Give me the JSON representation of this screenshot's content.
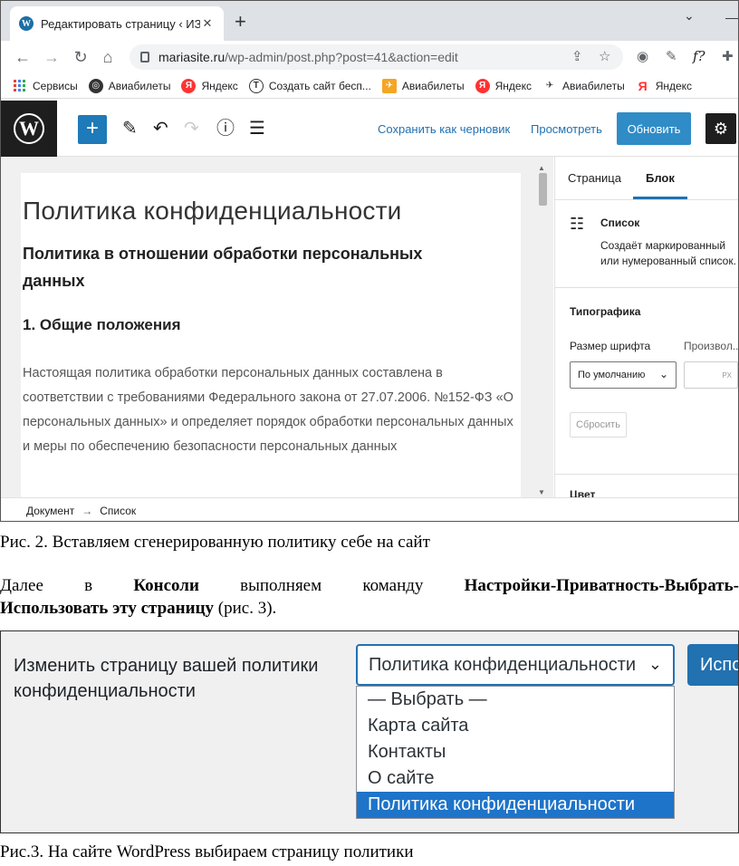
{
  "browser": {
    "tab_title": "Редактировать страницу ‹ ИЗУЧ",
    "tab_favicon": "W",
    "url_host": "mariasite.ru",
    "url_path": "/wp-admin/post.php?post=41&action=edit",
    "ext_f_label": "f?",
    "bookmarks": [
      {
        "label": "Сервисы",
        "icon": "apps-grid-icon"
      },
      {
        "label": "Авиабилеты",
        "icon": "globe-icon"
      },
      {
        "label": "Яндекс",
        "icon": "yandex-icon"
      },
      {
        "label": "Создать сайт бесп...",
        "icon": "t-icon"
      },
      {
        "label": "Авиабилеты",
        "icon": "plane-icon"
      },
      {
        "label": "Яндекс",
        "icon": "yandex-icon"
      },
      {
        "label": "Авиабилеты",
        "icon": "airplane-icon"
      },
      {
        "label": "Яндекс",
        "icon": "yandex-letter-icon"
      }
    ],
    "bookmark_glyphs": {
      "yandex": "Я",
      "t": "T"
    }
  },
  "editor": {
    "save_draft": "Сохранить как черновик",
    "preview": "Просмотреть",
    "update": "Обновить",
    "content": {
      "title": "Политика конфиденциальности",
      "heading": "Политика в отношении обработки персональных данных",
      "section": "1. Общие положения",
      "paragraph": "Настоящая политика обработки персональных данных составлена в соответствии с требованиями Федерального закона от 27.07.2006. №152-ФЗ «О персональных данных» и определяет порядок обработки персональных данных и меры по обеспечению безопасности персональных данных"
    },
    "sidebar": {
      "tab_page": "Страница",
      "tab_block": "Блок",
      "block_name": "Список",
      "block_desc": "Создаёт маркированный или нумерованный список.",
      "typography": "Типографика",
      "font_size_label": "Размер шрифта",
      "custom_label": "Произвол...",
      "font_size_value": "По умолчанию",
      "custom_unit": "PX",
      "reset": "Сбросить",
      "color": "Цвет"
    },
    "breadcrumb": {
      "document": "Документ",
      "arrow": "→",
      "current": "Список"
    }
  },
  "caption1": "Рис. 2. Вставляем сгенерированную политику себе на сайт",
  "paragraph": {
    "w1": "Далее",
    "w2": "в",
    "w3": "Консоли",
    "w4": "выполняем",
    "w5": "команду",
    "w6": "Настройки-Приватность-Выбрать-",
    "line2_bold": "Использовать эту страницу",
    "line2_rest": " (рис. 3)."
  },
  "privacy_settings": {
    "label": "Изменить страницу вашей политики конфиденциальности",
    "selected": "Политика конфиденциальности",
    "button": "Испо",
    "options": [
      "— Выбрать —",
      "Карта сайта",
      "Контакты",
      "О сайте",
      "Политика конфиденциальности"
    ],
    "highlighted_option": "Политика конфиденциальности"
  },
  "caption2": "Рис.3. На сайте WordPress выбираем страницу политики",
  "colors": {
    "wp_blue": "#2271b1",
    "wp_dark": "#1e1e1e",
    "highlight": "#1e74c8"
  }
}
